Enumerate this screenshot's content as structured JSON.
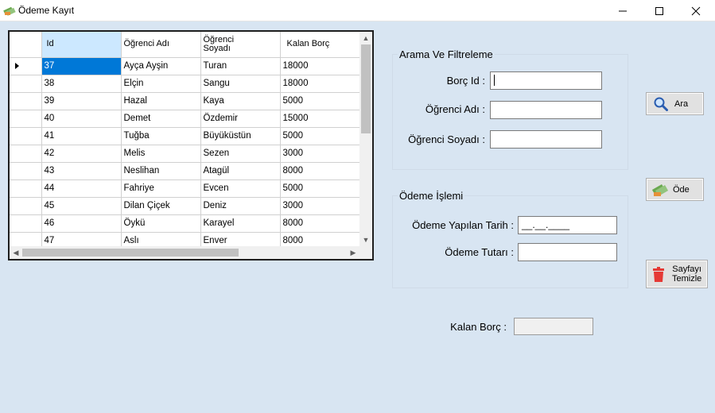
{
  "window": {
    "title": "Ödeme Kayıt"
  },
  "grid": {
    "columns": [
      "Id",
      "Öğrenci Adı",
      "Öğrenci Soyadı",
      "Kalan Borç"
    ],
    "rows": [
      [
        "37",
        "Ayça Ayşin",
        "Turan",
        "18000"
      ],
      [
        "38",
        "Elçin",
        "Sangu",
        "18000"
      ],
      [
        "39",
        "Hazal",
        "Kaya",
        "5000"
      ],
      [
        "40",
        "Demet",
        "Özdemir",
        "15000"
      ],
      [
        "41",
        "Tuğba",
        "Büyüküstün",
        "5000"
      ],
      [
        "42",
        "Melis",
        "Sezen",
        "3000"
      ],
      [
        "43",
        "Neslihan",
        "Atagül",
        "8000"
      ],
      [
        "44",
        "Fahriye",
        "Evcen",
        "5000"
      ],
      [
        "45",
        "Dilan Çiçek",
        "Deniz",
        "3000"
      ],
      [
        "46",
        "Öykü",
        "Karayel",
        "8000"
      ],
      [
        "47",
        "Aslı",
        "Enver",
        "8000"
      ]
    ]
  },
  "search_group": {
    "title": "Arama Ve Filtreleme",
    "borc_id_label": "Borç Id :",
    "ogrenci_adi_label": "Öğrenci Adı :",
    "ogrenci_soyadi_label": "Öğrenci Soyadı :",
    "borc_id_value": "",
    "ogrenci_adi_value": "",
    "ogrenci_soyadi_value": ""
  },
  "payment_group": {
    "title": "Ödeme İşlemi",
    "tarih_label": "Ödeme Yapılan Tarih :",
    "tutar_label": "Ödeme Tutarı :",
    "tarih_mask": "__.__.____",
    "tutar_value": ""
  },
  "kalan_borc": {
    "label": "Kalan Borç :",
    "value": ""
  },
  "buttons": {
    "ara": "Ara",
    "ode": "Öde",
    "temizle_line1": "Sayfayı",
    "temizle_line2": "Temizle"
  },
  "colors": {
    "selection": "#0078d7",
    "header_selected": "#cce8ff",
    "background": "#d8e5f2"
  }
}
